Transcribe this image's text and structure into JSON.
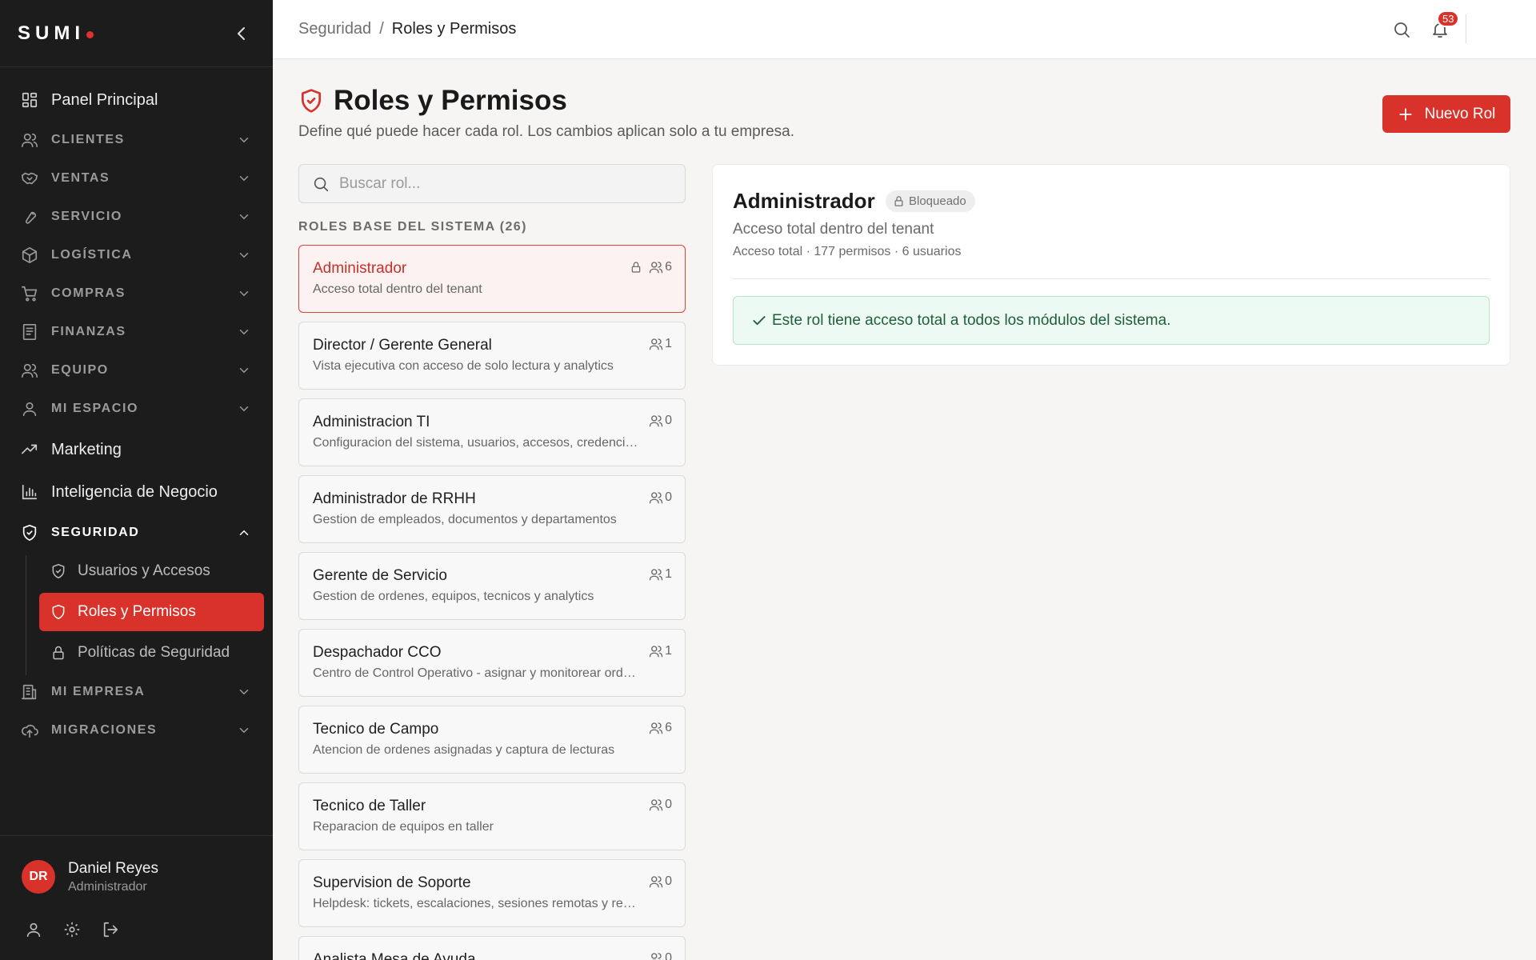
{
  "app": {
    "logo_text": "SUMI",
    "brand_color": "#d8322b"
  },
  "sidebar": {
    "items": [
      {
        "label": "Panel Principal",
        "icon": "dashboard-icon",
        "type": "main"
      },
      {
        "label": "CLIENTES",
        "icon": "users-icon",
        "type": "section"
      },
      {
        "label": "VENTAS",
        "icon": "handshake-icon",
        "type": "section"
      },
      {
        "label": "SERVICIO",
        "icon": "wrench-icon",
        "type": "section"
      },
      {
        "label": "LOGÍSTICA",
        "icon": "package-icon",
        "type": "section"
      },
      {
        "label": "COMPRAS",
        "icon": "cart-icon",
        "type": "section"
      },
      {
        "label": "FINANZAS",
        "icon": "receipt-icon",
        "type": "section"
      },
      {
        "label": "EQUIPO",
        "icon": "team-icon",
        "type": "section"
      },
      {
        "label": "MI ESPACIO",
        "icon": "user-icon",
        "type": "section"
      },
      {
        "label": "Marketing",
        "icon": "trending-up-icon",
        "type": "main"
      },
      {
        "label": "Inteligencia de Negocio",
        "icon": "bar-chart-icon",
        "type": "main"
      },
      {
        "label": "SEGURIDAD",
        "icon": "shield-icon",
        "type": "section",
        "expanded": true
      }
    ],
    "security_sub": [
      {
        "label": "Usuarios y Accesos",
        "icon": "shield-check-icon"
      },
      {
        "label": "Roles y Permisos",
        "icon": "shield-icon",
        "active": true
      },
      {
        "label": "Políticas de Seguridad",
        "icon": "lock-icon"
      }
    ],
    "items_after": [
      {
        "label": "MI EMPRESA",
        "icon": "building-icon",
        "type": "section"
      },
      {
        "label": "MIGRACIONES",
        "icon": "cloud-upload-icon",
        "type": "section"
      }
    ],
    "user": {
      "initials": "DR",
      "name": "Daniel Reyes",
      "role": "Administrador"
    }
  },
  "topbar": {
    "breadcrumb_parent": "Seguridad",
    "breadcrumb_sep": "/",
    "breadcrumb_current": "Roles y Permisos",
    "notifications_count": "53"
  },
  "page": {
    "title": "Roles y Permisos",
    "subtitle": "Define qué puede hacer cada rol. Los cambios aplican solo a tu empresa.",
    "new_button": "Nuevo Rol",
    "search_placeholder": "Buscar rol...",
    "section_label": "ROLES BASE DEL SISTEMA (26)"
  },
  "roles": [
    {
      "name": "Administrador",
      "desc": "Acceso total dentro del tenant",
      "users": "6",
      "locked": true,
      "selected": true
    },
    {
      "name": "Director / Gerente General",
      "desc": "Vista ejecutiva con acceso de solo lectura y analytics",
      "users": "1"
    },
    {
      "name": "Administracion TI",
      "desc": "Configuracion del sistema, usuarios, accesos, credenciales",
      "users": "0"
    },
    {
      "name": "Administrador de RRHH",
      "desc": "Gestion de empleados, documentos y departamentos",
      "users": "0"
    },
    {
      "name": "Gerente de Servicio",
      "desc": "Gestion de ordenes, equipos, tecnicos y analytics",
      "users": "1"
    },
    {
      "name": "Despachador CCO",
      "desc": "Centro de Control Operativo - asignar y monitorear ordenes",
      "users": "1"
    },
    {
      "name": "Tecnico de Campo",
      "desc": "Atencion de ordenes asignadas y captura de lecturas",
      "users": "6"
    },
    {
      "name": "Tecnico de Taller",
      "desc": "Reparacion de equipos en taller",
      "users": "0"
    },
    {
      "name": "Supervision de Soporte",
      "desc": "Helpdesk: tickets, escalaciones, sesiones remotas y reportes",
      "users": "0"
    },
    {
      "name": "Analista Mesa de Ayuda",
      "desc": "",
      "users": "0"
    }
  ],
  "detail": {
    "title": "Administrador",
    "badge": "Bloqueado",
    "description": "Acceso total dentro del tenant",
    "stats": "Acceso total · 177 permisos · 6 usuarios",
    "alert": "Este rol tiene acceso total a todos los módulos del sistema."
  }
}
